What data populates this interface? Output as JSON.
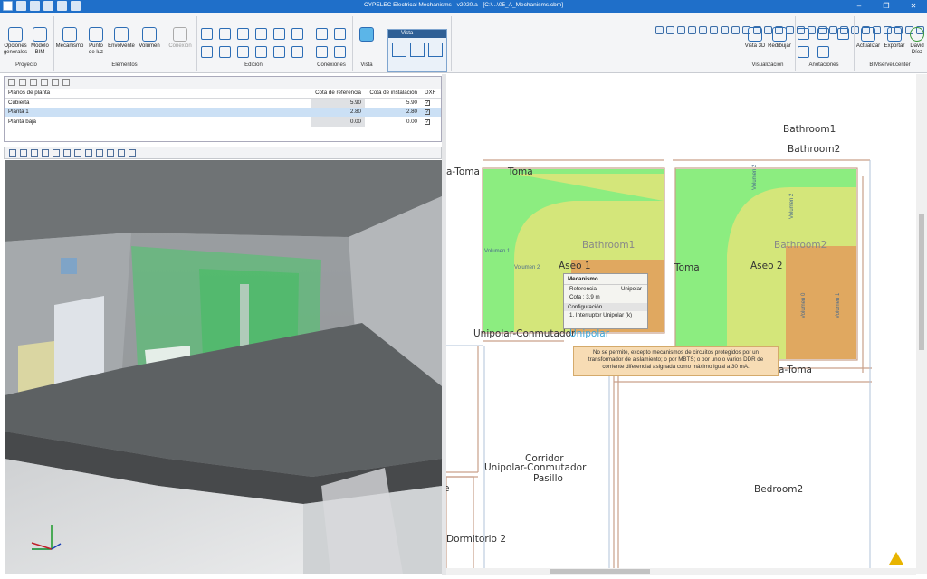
{
  "window": {
    "title": "CYPELEC Electrical Mechanisms - v2020.a - [C:\\...\\05_A_Mechanisms.cbm]"
  },
  "ribbon": {
    "proyecto": {
      "group": "Proyecto",
      "opciones": "Opciones generales",
      "modelo": "Modelo BIM"
    },
    "elementos": {
      "group": "Elementos",
      "mecanismo": "Mecanismo",
      "punto": "Punto de luz",
      "envolvente": "Envolvente",
      "volumen": "Volumen",
      "conexion": "Conexión"
    },
    "edicion": {
      "group": "Edición"
    },
    "conexiones": {
      "group": "Conexiones"
    },
    "vista_group": {
      "group": "Vista"
    },
    "vista_panel": {
      "title": "Vista"
    },
    "visualizacion": {
      "group": "Visualización",
      "vista3d": "Vista 3D",
      "redibujar": "Redibujar"
    },
    "anotaciones": {
      "group": "Anotaciones"
    },
    "bimserver": {
      "group": "BIMserver.center",
      "actualizar": "Actualizar",
      "exportar": "Exportar",
      "user": "David Díez"
    }
  },
  "floors": {
    "headers": {
      "name": "Planos de planta",
      "ref": "Cota de referencia",
      "inst": "Cota de instalación",
      "dxf": "DXF"
    },
    "rows": [
      {
        "name": "Cubierta",
        "ref": "5.90",
        "inst": "5.90",
        "dxf": "✓"
      },
      {
        "name": "Planta 1",
        "ref": "2.80",
        "inst": "2.80",
        "dxf": "✓"
      },
      {
        "name": "Planta baja",
        "ref": "0.00",
        "inst": "0.00",
        "dxf": "✓"
      }
    ]
  },
  "plan": {
    "labels": {
      "bathroom1_top": "Bathroom1",
      "bathroom2_top": "Bathroom2",
      "toma_left": "a-Toma",
      "toma_left2": "Toma",
      "bathroom1": "Bathroom1",
      "bathroom2": "Bathroom2",
      "aseo1": "Aseo 1",
      "aseo2": "Aseo 2",
      "toma_mid": "Toma",
      "unipolar_conm": "Unipolar-Conmutador",
      "unipolar": "Unipolar",
      "toma_right": "a-Toma",
      "corridor": "Corridor",
      "unipolar_conm2": "Unipolar-Conmutador",
      "pasillo": "Pasillo",
      "bedroom2": "Bedroom2",
      "dormitorio2": "Dormitorio 2",
      "e_fragment": "e"
    },
    "small_labels": {
      "vol1_a": "Volumen 1",
      "vol2_a": "Volumen 2",
      "vol2_b": "Volumen 2",
      "vol2_c": "Volumen 2",
      "vol0": "Volumen 0",
      "vol1_b": "Volumen 1"
    }
  },
  "tooltip": {
    "title": "Mecanismo",
    "ref_label": "Referencia",
    "ref_value": "Unipolar",
    "cota": "Cota : 3.9 m",
    "config_label": "Configuración",
    "config_item": "1. Interruptor Unipolar (k)"
  },
  "note": {
    "text": "No se permite, excepto mecanismos de circuitos protegidos por un transformador de aislamiento; o por MBTS; o por uno o varios DDR de corriente diferencial asignada como máximo igual a 30 mA."
  },
  "colors": {
    "titlebar": "#1f6fc9",
    "vol0": "#e0a860",
    "vol1": "#8ced80",
    "vol2": "#d4e67a"
  }
}
